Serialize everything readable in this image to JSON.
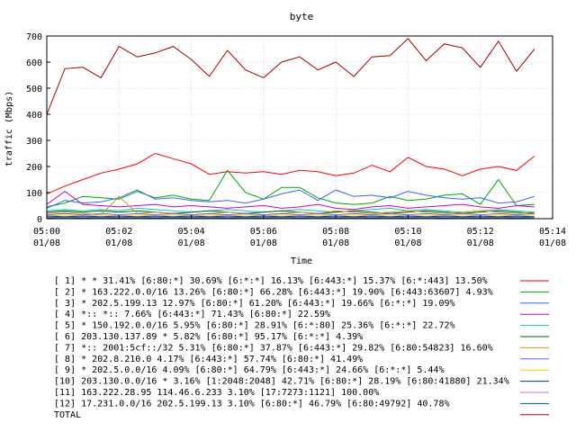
{
  "chart_data": {
    "type": "line",
    "title": "byte",
    "xlabel": "Time",
    "ylabel": "traffic (Mbps)",
    "ylim": [
      0,
      700
    ],
    "yticks": [
      0,
      100,
      200,
      300,
      400,
      500,
      600,
      700
    ],
    "xlim": [
      0,
      14
    ],
    "xticks": [
      {
        "x": 0,
        "time": "05:00",
        "date": "01/08"
      },
      {
        "x": 2,
        "time": "05:02",
        "date": "01/08"
      },
      {
        "x": 4,
        "time": "05:04",
        "date": "01/08"
      },
      {
        "x": 6,
        "time": "05:06",
        "date": "01/08"
      },
      {
        "x": 8,
        "time": "05:08",
        "date": "01/08"
      },
      {
        "x": 10,
        "time": "05:10",
        "date": "01/08"
      },
      {
        "x": 12,
        "time": "05:12",
        "date": "01/08"
      },
      {
        "x": 14,
        "time": "05:14",
        "date": "01/08"
      }
    ],
    "x": [
      0,
      0.5,
      1,
      1.5,
      2,
      2.5,
      3,
      3.5,
      4,
      4.5,
      5,
      5.5,
      6,
      6.5,
      7,
      7.5,
      8,
      8.5,
      9,
      9.5,
      10,
      10.5,
      11,
      11.5,
      12,
      12.5,
      13,
      13.5
    ],
    "grid": true,
    "legend_position": "bottom",
    "series": [
      {
        "name": "[ 1] * * 31.41%  [6:80:*] 30.69% [6:*:*] 16.13% [6:443:*] 15.37% [6:*:443] 13.50%",
        "color": "#ff0000",
        "values": [
          95,
          125,
          150,
          175,
          190,
          210,
          250,
          230,
          210,
          170,
          180,
          175,
          180,
          170,
          185,
          180,
          165,
          175,
          205,
          180,
          235,
          200,
          190,
          165,
          190,
          200,
          185,
          240
        ]
      },
      {
        "name": "[ 2] * 163.222.0.0/16 13.26%  [6:80:*] 66.28% [6:443:*] 19.90% [6:443:63607] 4.93%",
        "color": "#00aa00",
        "values": [
          45,
          60,
          85,
          80,
          75,
          105,
          80,
          90,
          75,
          70,
          185,
          100,
          75,
          120,
          120,
          80,
          60,
          55,
          60,
          85,
          70,
          75,
          90,
          95,
          55,
          150,
          50,
          55
        ]
      },
      {
        "name": "[ 3] * 202.5.199.13 12.97%  [6:80:*] 61.20% [6:443:*] 19.66% [6:*:*] 19.09%",
        "color": "#3366ff",
        "values": [
          40,
          70,
          60,
          65,
          80,
          110,
          75,
          80,
          70,
          65,
          70,
          60,
          75,
          95,
          110,
          70,
          110,
          85,
          90,
          80,
          105,
          90,
          80,
          75,
          80,
          60,
          65,
          85
        ]
      },
      {
        "name": "[ 4] *:: *:: 7.66%  [6:443:*] 71.43% [6:80:*] 22.59%",
        "color": "#cc00cc",
        "values": [
          55,
          105,
          55,
          50,
          45,
          50,
          55,
          45,
          50,
          45,
          40,
          45,
          50,
          40,
          45,
          55,
          40,
          35,
          45,
          50,
          40,
          45,
          50,
          55,
          45,
          40,
          50,
          45
        ]
      },
      {
        "name": "[ 5] * 150.192.0.0/16 5.95%  [6:80:*] 28.91% [6:*:80] 25.36% [6:*:*] 22.72%",
        "color": "#00cccc",
        "values": [
          30,
          35,
          30,
          35,
          30,
          40,
          35,
          30,
          25,
          30,
          35,
          30,
          25,
          30,
          35,
          30,
          25,
          30,
          35,
          40,
          30,
          35,
          30,
          25,
          30,
          35,
          30,
          25
        ]
      },
      {
        "name": "[ 6] 203.130.137.89 * 5.82%  [6:80:*] 95.17% [6:*:*] 4.39%",
        "color": "#006600",
        "values": [
          25,
          30,
          25,
          30,
          25,
          30,
          25,
          20,
          25,
          30,
          25,
          20,
          25,
          30,
          25,
          20,
          25,
          30,
          25,
          20,
          25,
          30,
          25,
          20,
          25,
          30,
          25,
          20
        ]
      },
      {
        "name": "[ 7] *:: 2001:5cf::/32 5.31%  [6:80:*] 37.87% [6:443:*] 29.82% [6:80:54823] 16.60%",
        "color": "#cc9900",
        "values": [
          20,
          25,
          20,
          15,
          85,
          20,
          25,
          20,
          15,
          20,
          25,
          20,
          15,
          20,
          25,
          20,
          30,
          25,
          20,
          25,
          30,
          25,
          20,
          25,
          30,
          25,
          20,
          25
        ]
      },
      {
        "name": "[ 8] * 202.8.210.0 4.17%  [6:443:*] 57.74% [6:80:*] 41.49%",
        "color": "#6666ff",
        "values": [
          15,
          20,
          15,
          20,
          15,
          20,
          15,
          20,
          15,
          20,
          15,
          20,
          15,
          20,
          15,
          20,
          15,
          20,
          15,
          20,
          15,
          20,
          15,
          20,
          15,
          20,
          15,
          20
        ]
      },
      {
        "name": "[ 9] * 202.5.0.0/16 4.09%  [6:80:*] 64.79% [6:443:*] 24.66% [6:*:*] 5.44%",
        "color": "#ffcc00",
        "values": [
          10,
          15,
          10,
          15,
          10,
          15,
          10,
          15,
          10,
          15,
          10,
          15,
          10,
          15,
          10,
          15,
          10,
          15,
          10,
          15,
          10,
          15,
          10,
          15,
          10,
          15,
          10,
          15
        ]
      },
      {
        "name": "[10] 203.130.0.0/16 * 3.16%  [1:2048:2048] 42.71% [6:80:*] 28.19% [6:80:41880] 21.34%",
        "color": "#003399",
        "values": [
          10,
          8,
          10,
          8,
          10,
          8,
          10,
          8,
          10,
          8,
          10,
          8,
          10,
          8,
          10,
          8,
          10,
          8,
          10,
          8,
          10,
          8,
          10,
          8,
          10,
          8,
          10,
          8
        ]
      },
      {
        "name": "[11] 163.222.28.95 114.46.6.233 3.10%  [17:7273:1121] 100.00%",
        "color": "#cc66ff",
        "values": [
          5,
          6,
          5,
          6,
          5,
          6,
          5,
          6,
          5,
          6,
          5,
          6,
          5,
          6,
          5,
          6,
          5,
          6,
          5,
          6,
          5,
          6,
          5,
          6,
          5,
          6,
          5,
          6
        ]
      },
      {
        "name": "[12] 17.231.0.0/16 202.5.199.13 3.10%  [6:80:*] 46.79% [6:80:49792] 40.78%",
        "color": "#006666",
        "values": [
          3,
          4,
          3,
          4,
          3,
          4,
          3,
          4,
          3,
          4,
          3,
          4,
          3,
          4,
          3,
          4,
          3,
          4,
          3,
          4,
          3,
          4,
          3,
          4,
          3,
          4,
          3,
          4
        ]
      },
      {
        "name": "TOTAL",
        "color": "#aa0000",
        "values": [
          400,
          575,
          580,
          540,
          660,
          620,
          635,
          660,
          610,
          545,
          645,
          570,
          540,
          600,
          620,
          570,
          600,
          545,
          620,
          625,
          690,
          605,
          670,
          655,
          580,
          680,
          565,
          650
        ]
      }
    ]
  }
}
